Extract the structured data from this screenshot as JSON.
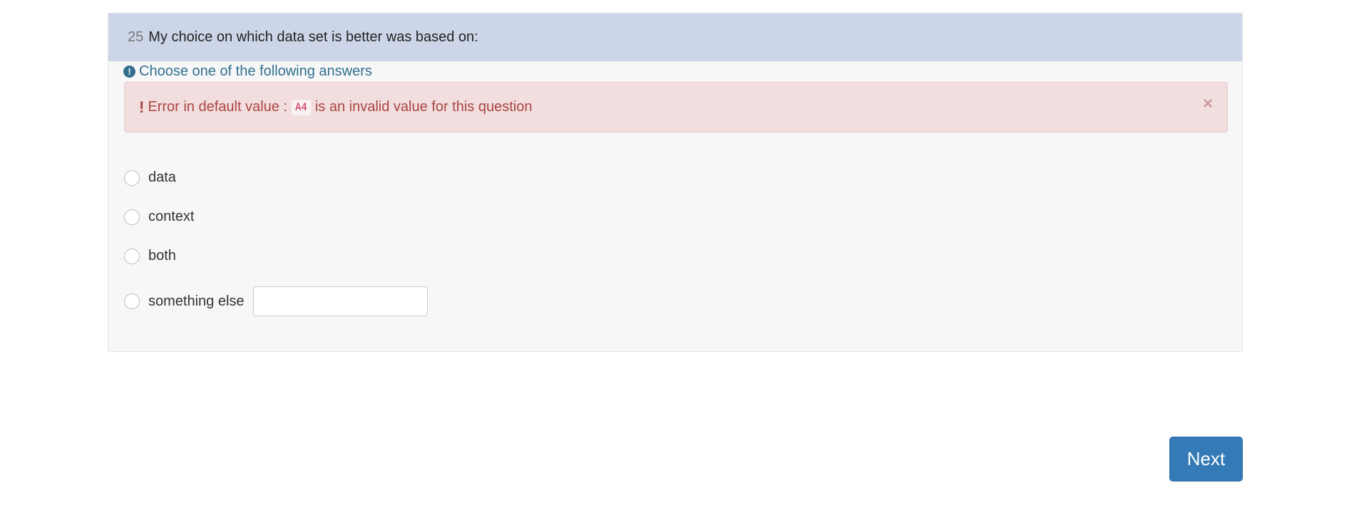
{
  "question": {
    "number": "25",
    "text": "My choice on which data set is better was based on:",
    "help_text": "Choose one of the following answers"
  },
  "alert": {
    "prefix": "Error in default value :",
    "code": "A4",
    "suffix": "is an invalid value for this question",
    "close": "×"
  },
  "options": [
    {
      "label": "data"
    },
    {
      "label": "context"
    },
    {
      "label": "both"
    },
    {
      "label": "something else"
    }
  ],
  "other_input": {
    "value": "",
    "placeholder": ""
  },
  "next_button": {
    "label": "Next"
  },
  "colors": {
    "header_bg": "#cdd6e8",
    "help": "#31708f",
    "alert_bg": "#f2dede",
    "alert_text": "#a94442",
    "primary": "#337ab7"
  }
}
